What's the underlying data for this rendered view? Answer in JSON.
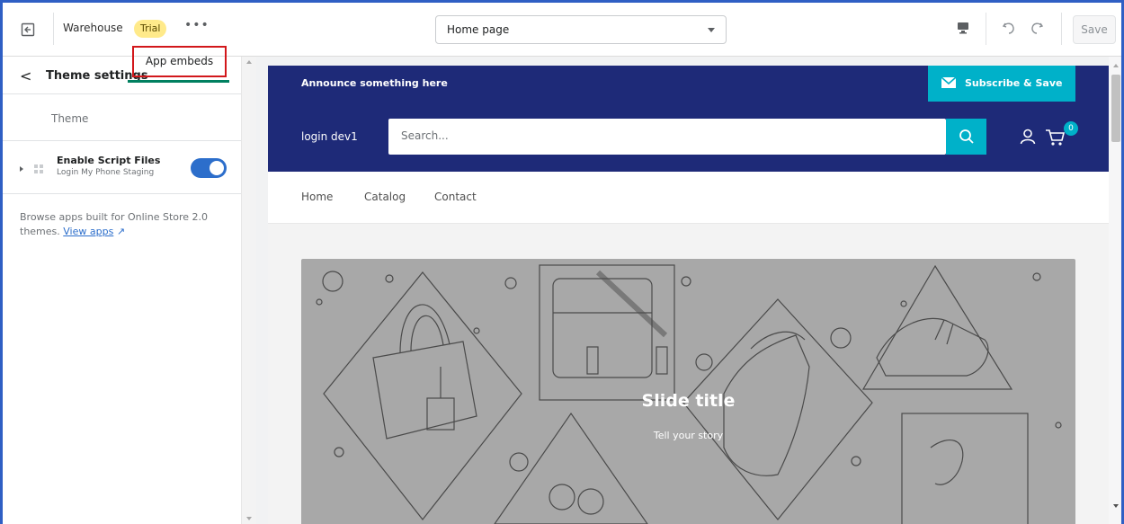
{
  "topbar": {
    "store_name": "Warehouse",
    "trial_badge": "Trial",
    "more": "•••",
    "page_select": "Home page",
    "save_label": "Save"
  },
  "sidebar": {
    "back": "<",
    "title": "Theme settings",
    "tabs": [
      {
        "label": "Theme"
      },
      {
        "label": "App embeds"
      }
    ],
    "embed": {
      "title": "Enable Script Files",
      "subtitle": "Login My Phone Staging",
      "enabled": true
    },
    "browse_text": "Browse apps built for Online Store 2.0 themes.",
    "browse_link": "View apps"
  },
  "store": {
    "announcement": "Announce something here",
    "subscribe": "Subscribe & Save",
    "store_title": "login dev1",
    "search_placeholder": "Search...",
    "cart_count": "0",
    "nav": [
      "Home",
      "Catalog",
      "Contact"
    ],
    "slide_title": "Slide title",
    "slide_subtitle": "Tell your story"
  },
  "colors": {
    "header_bg": "#1e2a78",
    "accent": "#00b1c9",
    "toggle_on": "#2c6ecb",
    "highlight_box": "#d2171b"
  }
}
